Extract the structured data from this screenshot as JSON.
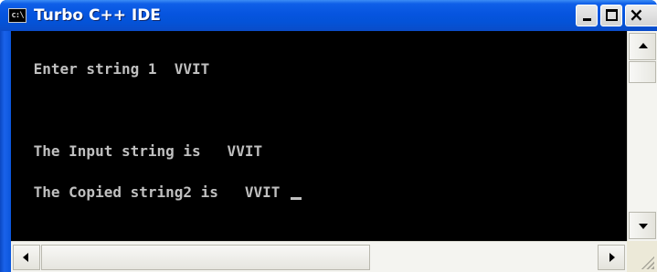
{
  "window": {
    "title": "Turbo C++ IDE",
    "icon_text": "c:\\",
    "icon": "console-app-icon",
    "buttons": {
      "minimize": "minimize-icon",
      "maximize": "maximize-icon",
      "close_glyph": "×"
    }
  },
  "console": {
    "lines": [
      " Enter string 1  VVIT",
      "",
      " The Input string is   VVIT",
      " The Copied string2 is   VVIT "
    ],
    "text_color": "#c0c0c0",
    "background": "#000000"
  },
  "scrollbars": {
    "vertical": {
      "up_icon": "arrow-up-icon",
      "down_icon": "arrow-down-icon"
    },
    "horizontal": {
      "left_icon": "arrow-left-icon",
      "right_icon": "arrow-right-icon"
    }
  },
  "colors": {
    "titlebar": "#0654df",
    "frame": "#0b56dc"
  }
}
